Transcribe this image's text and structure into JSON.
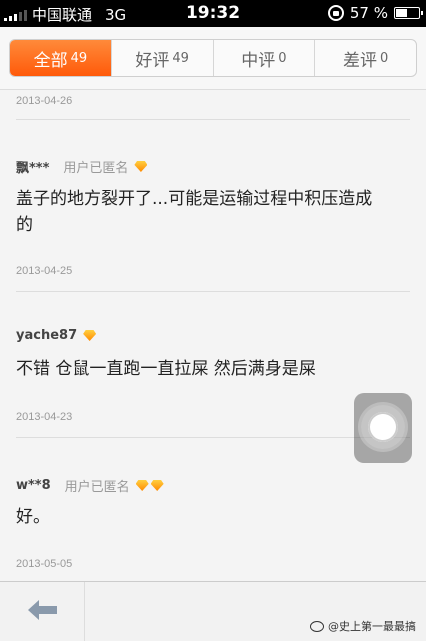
{
  "status_bar": {
    "carrier": "中国联通",
    "network": "3G",
    "time": "19:32",
    "battery": "57 %",
    "battery_level": 0.57
  },
  "tabs": [
    {
      "label": "全部",
      "count": "49",
      "active": true
    },
    {
      "label": "好评",
      "count": "49",
      "active": false
    },
    {
      "label": "中评",
      "count": "0",
      "active": false
    },
    {
      "label": "差评",
      "count": "0",
      "active": false
    }
  ],
  "reviews": [
    {
      "date": "2013-04-26"
    },
    {
      "user": "飘***",
      "anon_label": "用户已匿名",
      "gems": 1,
      "text_line1": "盖子的地方裂开了...可能是运输过程中积压造成",
      "text_line2": "的",
      "date": "2013-04-25"
    },
    {
      "user": "yache87",
      "gems": 1,
      "text_line1": "不错 仓鼠一直跑一直拉屎 然后满身是屎",
      "date": "2013-04-23"
    },
    {
      "user": "w**8",
      "anon_label": "用户已匿名",
      "gems": 2,
      "text_line1": "好。",
      "date": "2013-05-05"
    }
  ],
  "watermark": "@史上第一最最搞",
  "accent_color": "#ff6b1a"
}
